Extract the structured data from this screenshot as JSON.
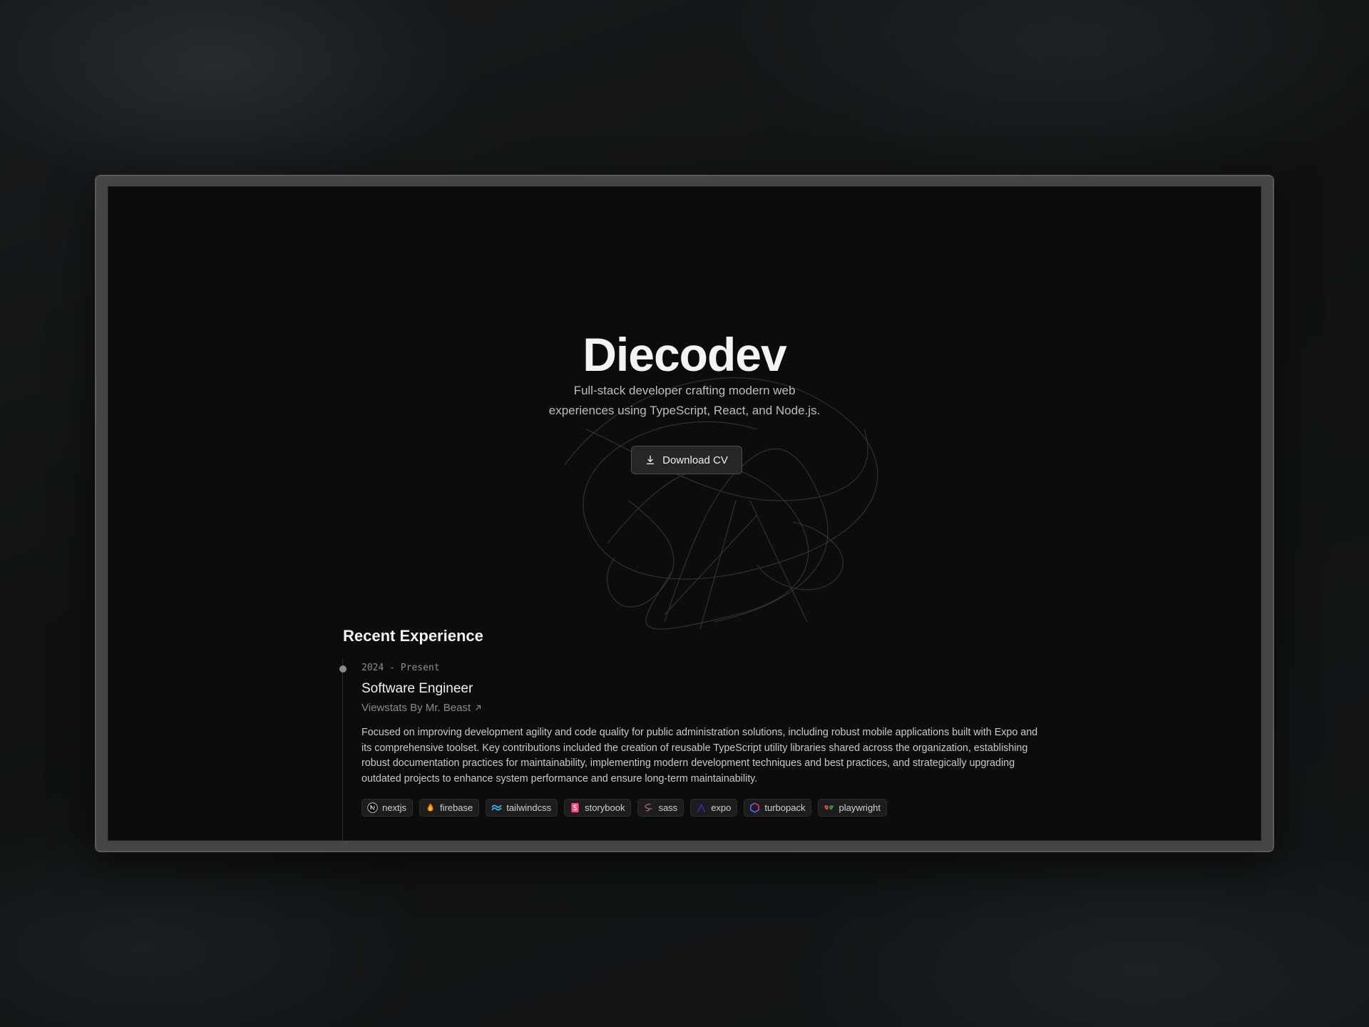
{
  "hero": {
    "title": "Diecodev",
    "subtitle_line1": "Full-stack developer crafting modern web",
    "subtitle_line2": "experiences using TypeScript, React, and Node.js.",
    "cta_label": "Download CV"
  },
  "experience": {
    "heading": "Recent Experience",
    "items": [
      {
        "date": "2024 - Present",
        "role": "Software Engineer",
        "company": "Viewstats By Mr. Beast",
        "description": "Focused on improving development agility and code quality for public administration solutions, including robust mobile applications built with Expo and its comprehensive toolset. Key contributions included the creation of reusable TypeScript utility libraries shared across the organization, establishing robust documentation practices for maintainability, implementing modern development techniques and best practices, and strategically upgrading outdated projects to enhance system performance and ensure long-term maintainability.",
        "tags": [
          {
            "label": "nextjs",
            "icon": "nextjs-icon"
          },
          {
            "label": "firebase",
            "icon": "firebase-icon"
          },
          {
            "label": "tailwindcss",
            "icon": "tailwindcss-icon"
          },
          {
            "label": "storybook",
            "icon": "storybook-icon"
          },
          {
            "label": "sass",
            "icon": "sass-icon"
          },
          {
            "label": "expo",
            "icon": "expo-icon"
          },
          {
            "label": "turbopack",
            "icon": "turbopack-icon"
          },
          {
            "label": "playwright",
            "icon": "playwright-icon"
          }
        ]
      }
    ]
  },
  "colors": {
    "page_background": "#121416",
    "device_frame": "#454545",
    "screen_background": "#0c0c0c",
    "text_primary": "#f4f4f4",
    "text_muted": "#8a8a8a"
  }
}
